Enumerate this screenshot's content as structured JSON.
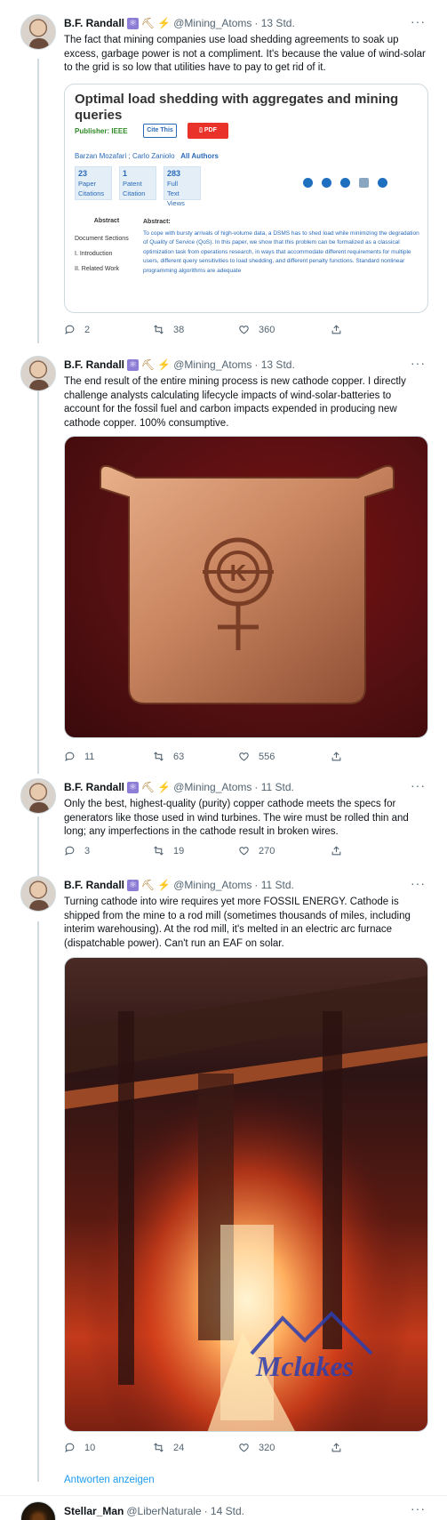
{
  "tweets": [
    {
      "name": "B.F. Randall",
      "handle": "@Mining_Atoms",
      "time": "· 13 Std.",
      "text": "The fact that mining companies use load shedding agreements to soak up excess, garbage power is not a compliment. It's because the value of wind-solar to the grid is so low that utilities have to pay to get rid of it.",
      "replies": "2",
      "retweets": "38",
      "likes": "360"
    },
    {
      "name": "B.F. Randall",
      "handle": "@Mining_Atoms",
      "time": "· 13 Std.",
      "text": "The end result of the entire mining process is new cathode copper. I directly challenge analysts calculating lifecycle impacts of wind-solar-batteries to account for the fossil fuel and carbon impacts expended in producing new cathode copper. 100% consumptive.",
      "replies": "11",
      "retweets": "63",
      "likes": "556"
    },
    {
      "name": "B.F. Randall",
      "handle": "@Mining_Atoms",
      "time": "· 11 Std.",
      "text": "Only the best, highest-quality (purity) copper cathode meets the specs for generators like those used in wind turbines. The wire must be rolled thin and long; any imperfections in the cathode result in broken wires.",
      "replies": "3",
      "retweets": "19",
      "likes": "270"
    },
    {
      "name": "B.F. Randall",
      "handle": "@Mining_Atoms",
      "time": "· 11 Std.",
      "text": "Turning cathode into wire requires yet more FOSSIL ENERGY. Cathode is shipped from the mine to a rod mill (sometimes thousands of miles, including interim warehousing). At the rod mill, it's melted in an electric arc furnace (dispatchable power). Can't run an EAF on solar.",
      "replies": "10",
      "retweets": "24",
      "likes": "320"
    }
  ],
  "paper_card": {
    "title": "Optimal load shedding with aggregates and mining queries",
    "publisher": "Publisher: IEEE",
    "cite_label": "Cite This",
    "pdf_label": "PDF",
    "author1": "Barzan Mozafari ;",
    "author2": "Carlo Zaniolo",
    "all_authors": "All Authors",
    "metrics": [
      {
        "n": "23",
        "l1": "Paper",
        "l2": "Citations"
      },
      {
        "n": "1",
        "l1": "Patent",
        "l2": "Citation"
      },
      {
        "n": "283",
        "l1": "Full",
        "l2": "Text Views"
      }
    ],
    "toc_heading": "Abstract",
    "toc_items": [
      "Document Sections",
      "I.  Introduction",
      "II.  Related Work"
    ],
    "abstract_heading": "Abstract:",
    "abstract_text": "To cope with bursty arrivals of high-volume data, a DSMS has to shed load while minimizing the degradation of Quality of Service (QoS). In this paper, we show that this problem can be formalized as a classical optimization task from operations research, in ways that accommodate different requirements for multiple users, different query sensitivities to load shedding, and different penalty functions. Standard nonlinear programming algorithms are adequate"
  },
  "ingot_letter": "K",
  "furnace_logo_text": "Mclakes",
  "show_replies": "Antworten anzeigen",
  "next_tweet": {
    "name": "Stellar_Man",
    "handle": "@LiberNaturale",
    "time": "· 14 Std."
  },
  "colors": {
    "link": "#1d9bf0",
    "muted": "#536471",
    "thread_line": "#cfd9de"
  }
}
